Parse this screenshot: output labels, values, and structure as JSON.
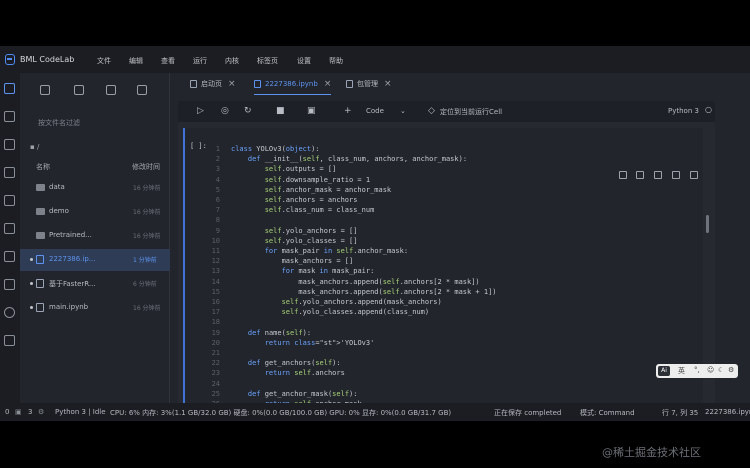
{
  "app": {
    "title": "BML CodeLab"
  },
  "menu": [
    "文件",
    "编辑",
    "查看",
    "运行",
    "内核",
    "标签页",
    "设置",
    "帮助"
  ],
  "tabs": [
    {
      "label": "启动页",
      "active": false
    },
    {
      "label": "2227386.ipynb",
      "active": true
    },
    {
      "label": "包管理",
      "active": false
    }
  ],
  "filebrowser": {
    "filter_placeholder": "按文件名过滤",
    "breadcrumb": "/",
    "col_name": "名称",
    "col_modified": "修改时间",
    "files": [
      {
        "name": "data",
        "modified": "16 分钟前",
        "type": "folder",
        "selected": false,
        "running": false
      },
      {
        "name": "demo",
        "modified": "16 分钟前",
        "type": "folder",
        "selected": false,
        "running": false
      },
      {
        "name": "Pretrained...",
        "modified": "16 分钟前",
        "type": "folder",
        "selected": false,
        "running": false
      },
      {
        "name": "2227386.ip...",
        "modified": "1 分钟前",
        "type": "notebook",
        "selected": true,
        "running": true
      },
      {
        "name": "基于FasterR...",
        "modified": "6 分钟前",
        "type": "notebook",
        "selected": false,
        "running": true
      },
      {
        "name": "main.ipynb",
        "modified": "16 分钟前",
        "type": "notebook",
        "selected": false,
        "running": true
      }
    ]
  },
  "toolbar": {
    "cell_type": "Code",
    "locate_label": "定位到当前运行Cell",
    "kernel": "Python 3"
  },
  "cell": {
    "prompt": "[ ]:",
    "lines": [
      {
        "n": "1",
        "code": "class YOLOv3(object):"
      },
      {
        "n": "2",
        "code": "    def __init__(self, class_num, anchors, anchor_mask):"
      },
      {
        "n": "3",
        "code": "        self.outputs = []"
      },
      {
        "n": "4",
        "code": "        self.downsample_ratio = 1"
      },
      {
        "n": "5",
        "code": "        self.anchor_mask = anchor_mask"
      },
      {
        "n": "6",
        "code": "        self.anchors = anchors"
      },
      {
        "n": "7",
        "code": "        self.class_num = class_num"
      },
      {
        "n": "8",
        "code": ""
      },
      {
        "n": "9",
        "code": "        self.yolo_anchors = []"
      },
      {
        "n": "10",
        "code": "        self.yolo_classes = []"
      },
      {
        "n": "11",
        "code": "        for mask_pair in self.anchor_mask:"
      },
      {
        "n": "12",
        "code": "            mask_anchors = []"
      },
      {
        "n": "13",
        "code": "            for mask in mask_pair:"
      },
      {
        "n": "14",
        "code": "                mask_anchors.append(self.anchors[2 * mask])"
      },
      {
        "n": "15",
        "code": "                mask_anchors.append(self.anchors[2 * mask + 1])"
      },
      {
        "n": "16",
        "code": "            self.yolo_anchors.append(mask_anchors)"
      },
      {
        "n": "17",
        "code": "            self.yolo_classes.append(class_num)"
      },
      {
        "n": "18",
        "code": ""
      },
      {
        "n": "19",
        "code": "    def name(self):"
      },
      {
        "n": "20",
        "code": "        return 'YOLOv3'"
      },
      {
        "n": "21",
        "code": ""
      },
      {
        "n": "22",
        "code": "    def get_anchors(self):"
      },
      {
        "n": "23",
        "code": "        return self.anchors"
      },
      {
        "n": "24",
        "code": ""
      },
      {
        "n": "25",
        "code": "    def get_anchor_mask(self):"
      },
      {
        "n": "26",
        "code": "        return self.anchor_mask"
      },
      {
        "n": "27",
        "code": ""
      }
    ]
  },
  "minibar": {
    "badge": "Ai",
    "lang": "英"
  },
  "status": {
    "count_a": "0",
    "count_b": "3",
    "kernel_state": "Python 3 | Idle",
    "resources": "CPU:  6% 内存:  3%(1.1 GB/32.0 GB) 硬盘:  0%(0.0 GB/100.0 GB)  GPU:  0%  显存:  0%(0.0 GB/31.7 GB)",
    "save_state": "正在保存 completed",
    "mode": "模式:  Command",
    "position": "行 7, 列 35",
    "filename": "2227386.ipyn"
  },
  "watermark": "@稀土掘金技术社区",
  "colors": {
    "accent": "#5d93f0",
    "cell_border": "#3f73d6",
    "keyword": "#6aa2ff",
    "string": "#d9a66c"
  }
}
